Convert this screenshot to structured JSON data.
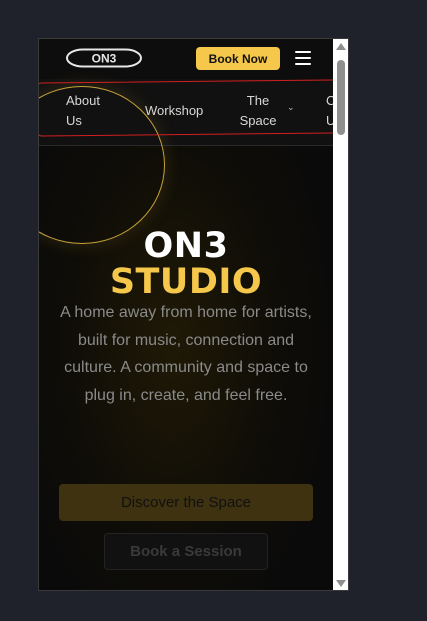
{
  "header": {
    "logo_text": "ON3",
    "book_button": "Book Now"
  },
  "nav": {
    "items": [
      {
        "label": "About Us"
      },
      {
        "label": "Workshop"
      },
      {
        "label": "The Space"
      },
      {
        "label": "C U"
      }
    ]
  },
  "hero": {
    "title_line1": "ON3",
    "title_line2": "STUDIO",
    "description": "A home away from home for artists, built for music, connection and culture. A community and space to plug in, create, and feel free.",
    "primary_button": "Discover the Space",
    "secondary_button": "Book a Session"
  },
  "colors": {
    "accent": "#f5c84c",
    "annotation": "#d11f1f"
  }
}
